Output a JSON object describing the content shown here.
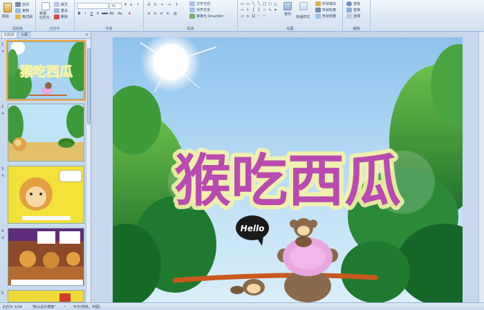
{
  "ribbon": {
    "clipboard": {
      "paste": "粘贴",
      "cut": "剪切",
      "copy": "复制",
      "format_painter": "格式刷",
      "label": "剪贴板"
    },
    "slides": {
      "new_slide": "新建\n幻灯片",
      "layout": "版式",
      "reset": "重设",
      "delete": "删除",
      "label": "幻灯片"
    },
    "font": {
      "font_name": "",
      "font_size": "32",
      "label": "字体"
    },
    "paragraph": {
      "text_direction": "文字方向",
      "align_text": "对齐文本",
      "smartart": "转换为 SmartArt",
      "label": "段落"
    },
    "drawing": {
      "arrange": "排列",
      "quick_styles": "快速样式",
      "shape_fill": "形状填充",
      "shape_outline": "形状轮廓",
      "shape_effects": "形状效果",
      "label": "绘图"
    },
    "editing": {
      "find": "查找",
      "replace": "替换",
      "select": "选择",
      "label": "编辑"
    }
  },
  "left_pane": {
    "tab_slides": "幻灯片",
    "tab_outline": "大纲",
    "thumbnails": [
      {
        "number": "1",
        "title": "猴吃西瓜"
      },
      {
        "number": "2",
        "text": ""
      },
      {
        "number": "3",
        "text": ""
      },
      {
        "number": "4",
        "text": ""
      },
      {
        "number": "5",
        "text": ""
      }
    ]
  },
  "slide": {
    "title": "猴吃西瓜",
    "speech_bubble": "Hello"
  },
  "status": {
    "slide_info": "幻灯片 1/14",
    "theme": "\"默认设计模板\"",
    "language": "中文(简体，中国)"
  },
  "colors": {
    "title_fill": "#b94bb0",
    "title_glow": "#f5f3a8",
    "accent_orange": "#f4a53a"
  }
}
